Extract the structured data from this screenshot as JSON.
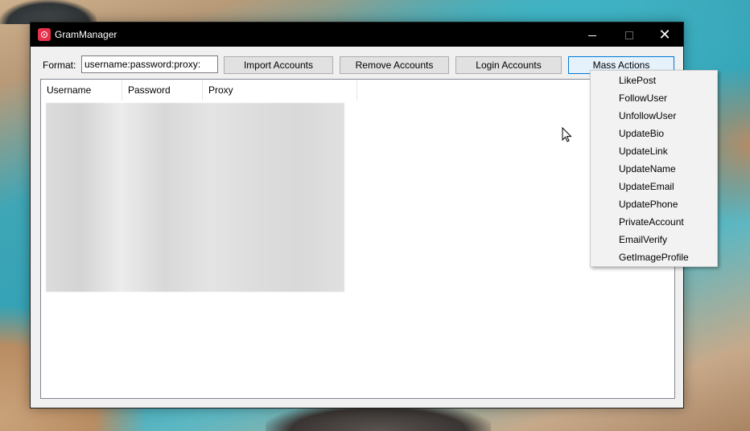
{
  "window": {
    "title": "GramManager"
  },
  "toolbar": {
    "format_label": "Format:",
    "format_value": "username:password:proxy:",
    "import_label": "Import Accounts",
    "remove_label": "Remove Accounts",
    "login_label": "Login Accounts",
    "mass_label": "Mass Actions"
  },
  "grid": {
    "columns": [
      "Username",
      "Password",
      "Proxy"
    ]
  },
  "mass_menu": {
    "items": [
      "LikePost",
      "FollowUser",
      "UnfollowUser",
      "UpdateBio",
      "UpdateLink",
      "UpdateName",
      "UpdateEmail",
      "UpdatePhone",
      "PrivateAccount",
      "EmailVerify",
      "GetImageProfile"
    ]
  },
  "icons": {
    "app": "gram-manager-app-icon",
    "minimize": "minimize-icon",
    "maximize": "maximize-icon",
    "close": "close-icon",
    "cursor": "mouse-pointer-icon"
  },
  "colors": {
    "titlebar": "#000000",
    "app_icon": "#e8304a",
    "focused_button_border": "#0078d7"
  }
}
